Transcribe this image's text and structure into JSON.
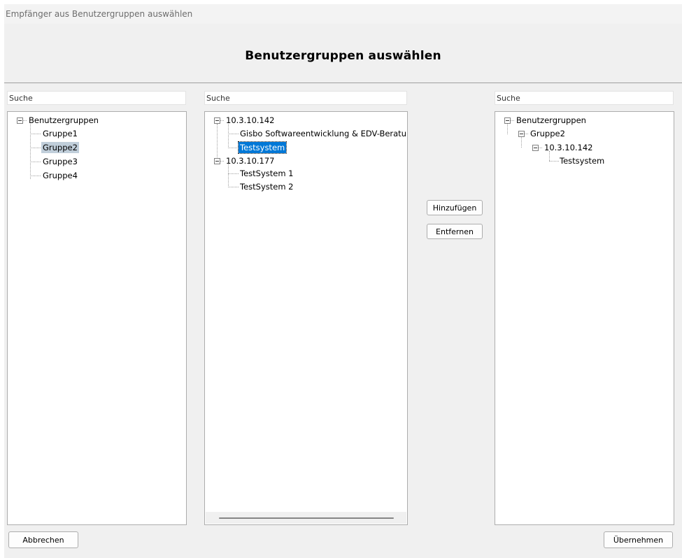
{
  "window": {
    "title": "Empfänger aus Benutzergruppen auswählen"
  },
  "header": {
    "title": "Benutzergruppen auswählen"
  },
  "left_panel": {
    "search_placeholder": "Suche",
    "root": "Benutzergruppen",
    "items": [
      "Gruppe1",
      "Gruppe2",
      "Gruppe3",
      "Gruppe4"
    ],
    "selected": "Gruppe2"
  },
  "middle_panel": {
    "search_placeholder": "Suche",
    "hosts": [
      {
        "label": "10.3.10.142",
        "children": [
          "Gisbo Softwareentwicklung & EDV-Beratung",
          "Testsystem"
        ]
      },
      {
        "label": "10.3.10.177",
        "children": [
          "TestSystem 1",
          "TestSystem 2"
        ]
      }
    ],
    "selected": "Testsystem"
  },
  "actions": {
    "add_label": "Hinzufügen",
    "remove_label": "Entfernen"
  },
  "right_panel": {
    "search_placeholder": "Suche",
    "root": "Benutzergruppen",
    "group": "Gruppe2",
    "host": "10.3.10.142",
    "leaf": "Testsystem"
  },
  "footer": {
    "cancel_label": "Abbrechen",
    "apply_label": "Übernehmen"
  },
  "colors": {
    "selection_blue": "#0078d7",
    "selection_gray": "#c0ceda",
    "background": "#f0f0f0"
  }
}
